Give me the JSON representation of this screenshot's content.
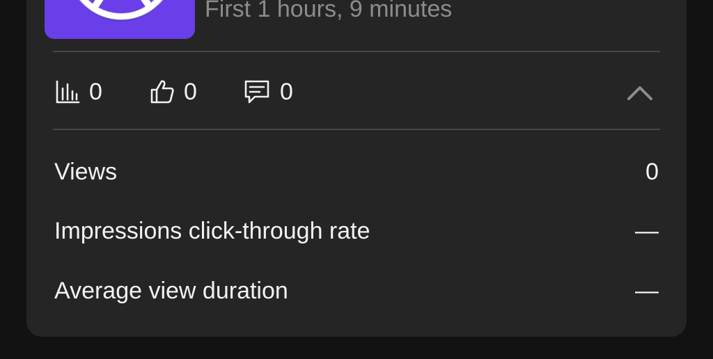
{
  "video": {
    "subtitle": "First 1 hours, 9 minutes"
  },
  "stats": {
    "views_icon": "bar-chart-icon",
    "views_count": "0",
    "likes_icon": "thumbs-up-icon",
    "likes_count": "0",
    "comments_icon": "comment-icon",
    "comments_count": "0",
    "collapse_icon": "chevron-up-icon"
  },
  "metrics": [
    {
      "label": "Views",
      "value": "0"
    },
    {
      "label": "Impressions click-through rate",
      "value": "—"
    },
    {
      "label": "Average view duration",
      "value": "—"
    }
  ],
  "colors": {
    "background": "#121212",
    "card": "#252525",
    "thumbnail": "#6a3ee8",
    "text": "#f2f2f2",
    "muted": "#8c8c8c"
  }
}
